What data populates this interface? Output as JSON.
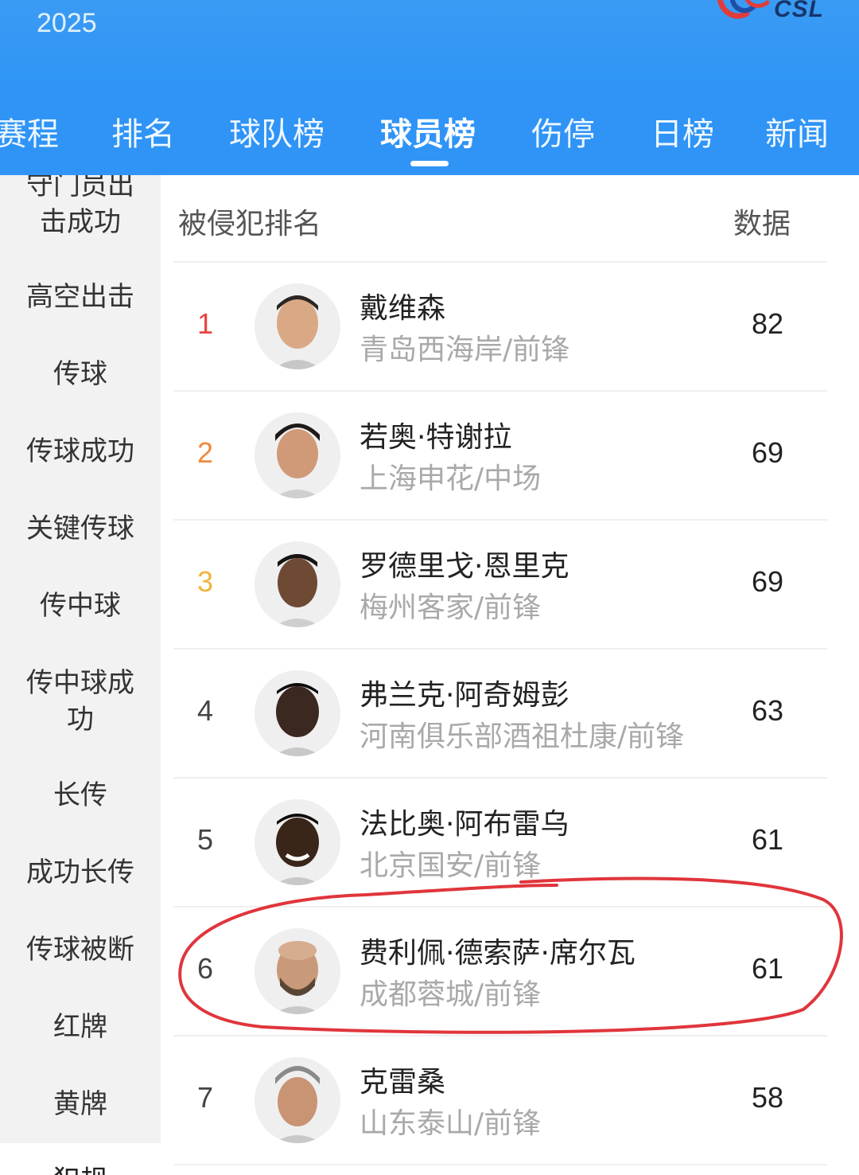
{
  "header": {
    "season": "2025",
    "logo_text": "CSL"
  },
  "nav": {
    "tabs": [
      {
        "label": "赛程"
      },
      {
        "label": "排名"
      },
      {
        "label": "球队榜"
      },
      {
        "label": "球员榜"
      },
      {
        "label": "伤停"
      },
      {
        "label": "日榜"
      },
      {
        "label": "新闻"
      }
    ],
    "active_tab": "球员榜",
    "accent_color": "#2f94f6"
  },
  "sidebar": {
    "items": [
      {
        "label": "守门员出击成功"
      },
      {
        "label": "高空出击"
      },
      {
        "label": "传球"
      },
      {
        "label": "传球成功"
      },
      {
        "label": "关键传球"
      },
      {
        "label": "传中球"
      },
      {
        "label": "传中球成功"
      },
      {
        "label": "长传"
      },
      {
        "label": "成功长传"
      },
      {
        "label": "传球被断"
      },
      {
        "label": "红牌"
      },
      {
        "label": "黄牌"
      },
      {
        "label": "犯规"
      }
    ]
  },
  "ranking": {
    "title": "被侵犯排名",
    "data_label": "数据",
    "rank_colors": {
      "1": "#e8433f",
      "2": "#f08a3c",
      "3": "#f2b43c"
    },
    "rows": [
      {
        "rank": "1",
        "name": "戴维森",
        "team": "青岛西海岸/前锋",
        "value": "82"
      },
      {
        "rank": "2",
        "name": "若奥·特谢拉",
        "team": "上海申花/中场",
        "value": "69"
      },
      {
        "rank": "3",
        "name": "罗德里戈·恩里克",
        "team": "梅州客家/前锋",
        "value": "69"
      },
      {
        "rank": "4",
        "name": "弗兰克·阿奇姆彭",
        "team": "河南俱乐部酒祖杜康/前锋",
        "value": "63"
      },
      {
        "rank": "5",
        "name": "法比奥·阿布雷乌",
        "team": "北京国安/前锋",
        "value": "61"
      },
      {
        "rank": "6",
        "name": "费利佩·德索萨·席尔瓦",
        "team": "成都蓉城/前锋",
        "value": "61",
        "highlighted": true
      },
      {
        "rank": "7",
        "name": "克雷桑",
        "team": "山东泰山/前锋",
        "value": "58"
      }
    ]
  },
  "annotation": {
    "color": "#e0353c"
  }
}
